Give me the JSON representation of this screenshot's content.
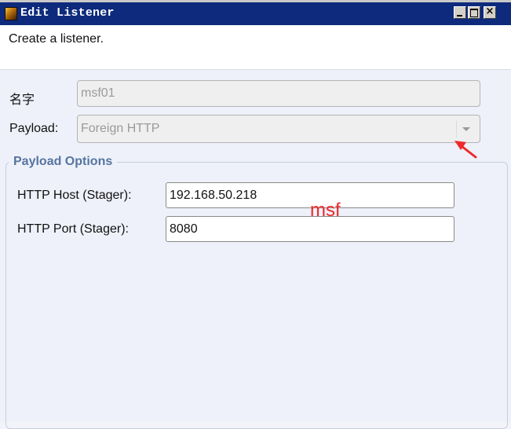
{
  "window": {
    "title": "Edit Listener",
    "icon": "cobalt-strike-icon",
    "controls": {
      "minimize": "_",
      "maximize": "□",
      "close": "×"
    }
  },
  "banner": {
    "text": "Create a listener."
  },
  "form": {
    "name_label": "名字",
    "name_value": "msf01",
    "payload_label": "Payload:",
    "payload_value": "Foreign HTTP"
  },
  "payload_options": {
    "legend": "Payload Options",
    "host_label": "HTTP Host (Stager):",
    "host_value": "192.168.50.218",
    "port_label": "HTTP Port (Stager):",
    "port_value": "8080"
  },
  "annotation": {
    "text": "msf",
    "color": "#ee2a2a"
  },
  "colors": {
    "titlebar": "#0d2a7c",
    "legend": "#5574a0",
    "background": "#eef1f9"
  }
}
